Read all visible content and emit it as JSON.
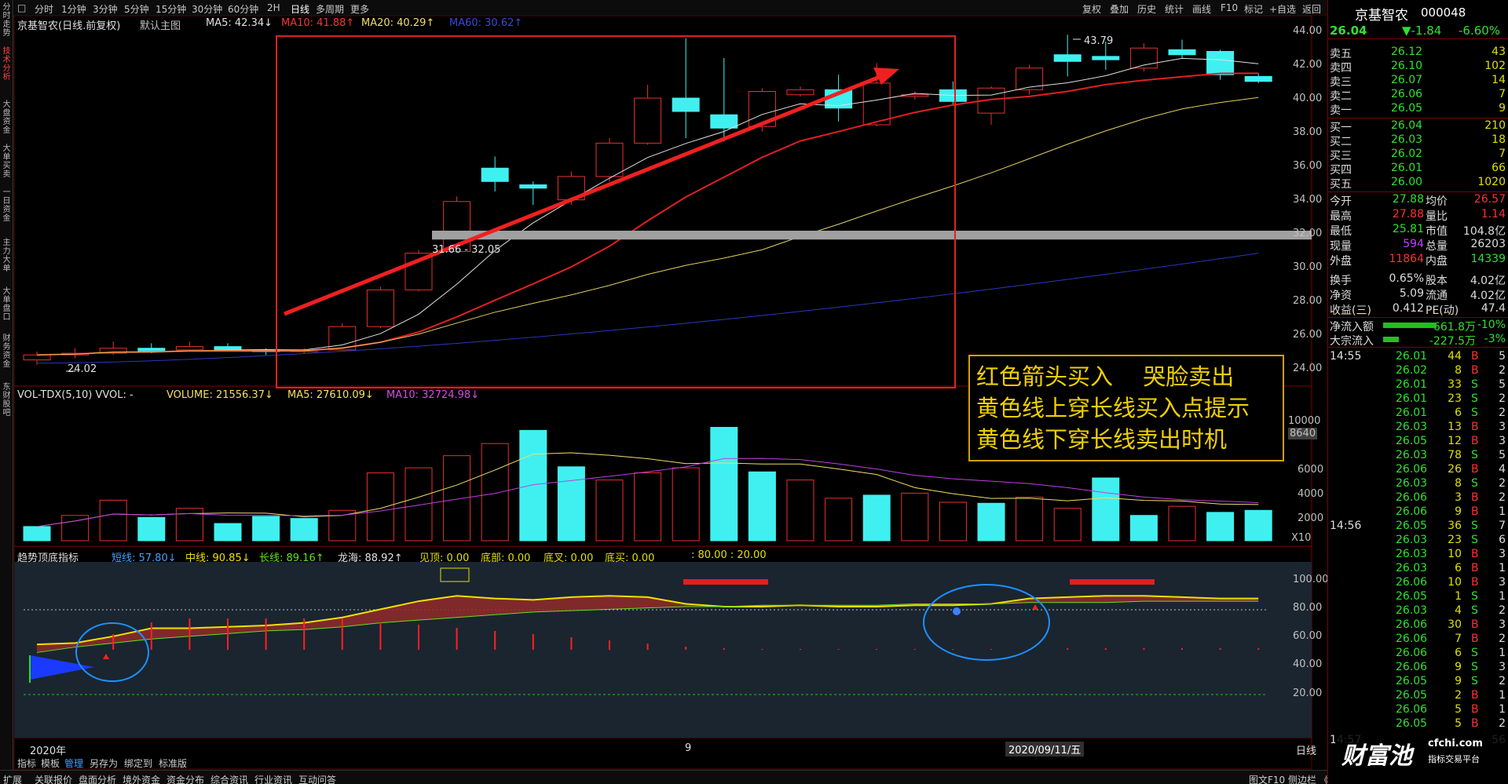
{
  "toolbar": {
    "periods": [
      "分时",
      "1分钟",
      "3分钟",
      "5分钟",
      "15分钟",
      "30分钟",
      "60分钟",
      "2H",
      "日线",
      "多周期",
      "更多"
    ],
    "right": [
      "复权",
      "叠加",
      "历史",
      "统计",
      "画线",
      "F10",
      "标记",
      "+自选",
      "返回"
    ]
  },
  "left_sidebar": {
    "items": [
      "分时走势",
      "技术分析",
      "大盘资金",
      "大单买卖",
      "一日资金",
      "主力大单",
      "大单盘口",
      "财务资金",
      "东财股吧"
    ]
  },
  "main_legend": {
    "name": "京基智农(日线.前复权)",
    "template": "默认主图",
    "ma5": "MA5: 42.34↓",
    "ma10": "MA10: 41.88↑",
    "ma20": "MA20: 40.29↑",
    "ma60": "MA60: 30.62↑"
  },
  "colors": {
    "up": "#e83030",
    "down": "#40f0f0",
    "ma5": "#e0e0e0",
    "ma10": "#e02020",
    "ma20": "#e0d060",
    "ma60": "#2838c0",
    "annotation": "#f0d000"
  },
  "price_axis": [
    "44.00",
    "42.00",
    "40.00",
    "38.00",
    "36.00",
    "34.00",
    "32.00",
    "30.00",
    "28.00",
    "26.00",
    "24.00"
  ],
  "price_labels": {
    "high": "43.79",
    "low": "24.02",
    "support": "31.66 - 32.05"
  },
  "volume_legend": {
    "name": "VOL-TDX(5,10) VVOL: -",
    "volume": "VOLUME: 21556.37↓",
    "ma5": "MA5: 27610.09↓",
    "ma10": "MA10: 32724.98↓"
  },
  "volume_axis": [
    "10000",
    "8640",
    "6000",
    "4000",
    "2000",
    "X10"
  ],
  "indicator_legend": {
    "name": "趋势顶底指标",
    "short": "短线: 57.80↓",
    "mid": "中线: 90.85↓",
    "long": "长线: 89.16↑",
    "longhai": "龙海: 88.92↑",
    "top": "见顶: 0.00",
    "bottom": "底部: 0.00",
    "cross": "底叉: 0.00",
    "buy": "底买: 0.00",
    "extra": ": 80.00 : 20.00"
  },
  "indicator_axis": [
    "100.00",
    "80.00",
    "60.00",
    "40.00",
    "20.00"
  ],
  "date_axis": {
    "start": "2020年",
    "mid": "9",
    "cursor": "2020/09/11/五",
    "period": "日线"
  },
  "annotation": [
    "红色箭头买入　 哭脸卖出",
    "黄色线上穿长线买入点提示",
    "黄色线下穿长线卖出时机"
  ],
  "bottom_tabs": [
    "指标",
    "模板",
    "管理",
    "另存为",
    "绑定到",
    "标准版"
  ],
  "status_bar": [
    "扩展",
    "关联报价",
    "盘面分析",
    "境外资金",
    "资金分布",
    "综合资讯",
    "行业资讯",
    "互动问答"
  ],
  "status_right": "图文F10 侧边栏 《",
  "watermark": {
    "brand": "财富池",
    "site": "cfchi.com",
    "tagline": "指标交易平台"
  },
  "quote": {
    "name": "京基智农",
    "code": "000048",
    "price": "26.04",
    "change": "▼-1.84",
    "pct": "-6.60%",
    "asks": [
      [
        "卖五",
        "26.12",
        "43"
      ],
      [
        "卖四",
        "26.10",
        "102"
      ],
      [
        "卖三",
        "26.07",
        "14"
      ],
      [
        "卖二",
        "26.06",
        "7"
      ],
      [
        "卖一",
        "26.05",
        "9"
      ]
    ],
    "bids": [
      [
        "买一",
        "26.04",
        "210"
      ],
      [
        "买二",
        "26.03",
        "18"
      ],
      [
        "买三",
        "26.02",
        "7"
      ],
      [
        "买四",
        "26.01",
        "66"
      ],
      [
        "买五",
        "26.00",
        "1020"
      ]
    ],
    "stats": [
      [
        "今开",
        "27.88",
        "均价",
        "26.57"
      ],
      [
        "最高",
        "27.88",
        "量比",
        "1.14"
      ],
      [
        "最低",
        "25.81",
        "市值",
        "104.8亿"
      ],
      [
        "现量",
        "594",
        "总量",
        "26203"
      ],
      [
        "外盘",
        "11864",
        "内盘",
        "14339"
      ],
      [
        "换手",
        "0.65%",
        "股本",
        "4.02亿"
      ],
      [
        "净资",
        "5.09",
        "流通",
        "4.02亿"
      ],
      [
        "收益(三)",
        "0.412",
        "PE(动)",
        "47.4"
      ]
    ],
    "flows": [
      [
        "净流入额",
        "-661.8万",
        "-10%"
      ],
      [
        "大宗流入",
        "-227.5万",
        "-3%"
      ]
    ],
    "ticks_title1": "14:55",
    "ticks_title2": "14:56",
    "ticks": [
      [
        "26.01",
        "44",
        "B",
        "5"
      ],
      [
        "26.02",
        "8",
        "B",
        "2"
      ],
      [
        "26.01",
        "33",
        "S",
        "5"
      ],
      [
        "26.01",
        "23",
        "S",
        "2"
      ],
      [
        "26.01",
        "6",
        "S",
        "2"
      ],
      [
        "26.03",
        "13",
        "B",
        "3"
      ],
      [
        "26.05",
        "12",
        "B",
        "3"
      ],
      [
        "26.03",
        "78",
        "S",
        "5"
      ],
      [
        "26.06",
        "26",
        "B",
        "4"
      ],
      [
        "26.03",
        "8",
        "S",
        "2"
      ],
      [
        "26.06",
        "3",
        "B",
        "2"
      ],
      [
        "26.06",
        "9",
        "B",
        "1"
      ],
      [
        "26.05",
        "36",
        "S",
        "7"
      ],
      [
        "26.03",
        "23",
        "S",
        "6"
      ],
      [
        "26.03",
        "10",
        "B",
        "3"
      ],
      [
        "26.03",
        "6",
        "B",
        "1"
      ],
      [
        "26.06",
        "10",
        "B",
        "3"
      ],
      [
        "26.05",
        "1",
        "S",
        "1"
      ],
      [
        "26.03",
        "4",
        "S",
        "2"
      ],
      [
        "26.06",
        "30",
        "B",
        "3"
      ],
      [
        "26.06",
        "7",
        "B",
        "2"
      ],
      [
        "26.06",
        "6",
        "S",
        "1"
      ],
      [
        "26.06",
        "9",
        "S",
        "3"
      ],
      [
        "26.05",
        "9",
        "S",
        "2"
      ],
      [
        "26.05",
        "2",
        "B",
        "1"
      ],
      [
        "26.06",
        "5",
        "B",
        "1"
      ],
      [
        "26.05",
        "5",
        "B",
        "2"
      ]
    ],
    "last_time": "14:57",
    "last_val": "56"
  },
  "candles": [
    [
      24.3,
      24.6,
      24.0,
      24.8
    ],
    [
      24.6,
      24.7,
      24.4,
      25.0
    ],
    [
      24.7,
      25.0,
      24.6,
      25.4
    ],
    [
      25.0,
      24.8,
      24.7,
      25.3
    ],
    [
      24.9,
      25.1,
      24.8,
      25.4
    ],
    [
      25.1,
      24.9,
      24.8,
      25.3
    ],
    [
      24.9,
      24.8,
      24.6,
      25.0
    ],
    [
      24.8,
      24.9,
      24.7,
      25.0
    ],
    [
      24.9,
      26.3,
      24.9,
      26.5
    ],
    [
      26.3,
      28.5,
      26.2,
      28.7
    ],
    [
      28.5,
      30.7,
      28.4,
      30.9
    ],
    [
      30.8,
      33.8,
      30.7,
      34.1
    ],
    [
      35.8,
      35.0,
      34.4,
      36.5
    ],
    [
      34.8,
      34.6,
      33.6,
      35.0
    ],
    [
      33.9,
      35.3,
      33.6,
      35.6
    ],
    [
      35.3,
      37.3,
      35.0,
      37.6
    ],
    [
      37.3,
      40.0,
      37.2,
      40.8
    ],
    [
      40.0,
      39.2,
      37.6,
      43.6
    ],
    [
      39.0,
      38.2,
      37.4,
      42.4
    ],
    [
      38.3,
      40.4,
      38.0,
      40.6
    ],
    [
      40.2,
      40.5,
      40.1,
      40.7
    ],
    [
      40.5,
      39.4,
      38.6,
      41.4
    ],
    [
      38.4,
      40.9,
      38.3,
      42.1
    ],
    [
      40.1,
      40.2,
      39.9,
      40.4
    ],
    [
      40.5,
      39.8,
      39.6,
      41.0
    ],
    [
      39.1,
      40.6,
      38.4,
      40.7
    ],
    [
      40.5,
      41.8,
      40.2,
      42.0
    ],
    [
      42.6,
      42.2,
      41.3,
      43.8
    ],
    [
      42.5,
      42.3,
      41.7,
      43.4
    ],
    [
      41.8,
      43.0,
      41.6,
      43.3
    ],
    [
      42.9,
      42.6,
      42.4,
      43.5
    ],
    [
      42.8,
      41.4,
      41.1,
      42.9
    ],
    [
      41.3,
      41.0,
      40.9,
      41.5
    ]
  ],
  "volumes": [
    [
      1400,
      0
    ],
    [
      2500,
      1
    ],
    [
      4000,
      1
    ],
    [
      2300,
      0
    ],
    [
      3200,
      1
    ],
    [
      1700,
      0
    ],
    [
      2400,
      0
    ],
    [
      2200,
      0
    ],
    [
      3000,
      1
    ],
    [
      6700,
      1
    ],
    [
      7200,
      1
    ],
    [
      8400,
      1
    ],
    [
      9600,
      1
    ],
    [
      10900,
      0
    ],
    [
      7300,
      0
    ],
    [
      6000,
      1
    ],
    [
      6700,
      1
    ],
    [
      7200,
      1
    ],
    [
      11200,
      0
    ],
    [
      6800,
      0
    ],
    [
      6000,
      1
    ],
    [
      4200,
      1
    ],
    [
      4500,
      0
    ],
    [
      4700,
      1
    ],
    [
      3800,
      1
    ],
    [
      3700,
      0
    ],
    [
      4300,
      1
    ],
    [
      3200,
      1
    ],
    [
      6200,
      0
    ],
    [
      2500,
      0
    ],
    [
      3400,
      1
    ],
    [
      2800,
      0
    ],
    [
      3000,
      0
    ],
    [
      2200,
      1
    ]
  ]
}
